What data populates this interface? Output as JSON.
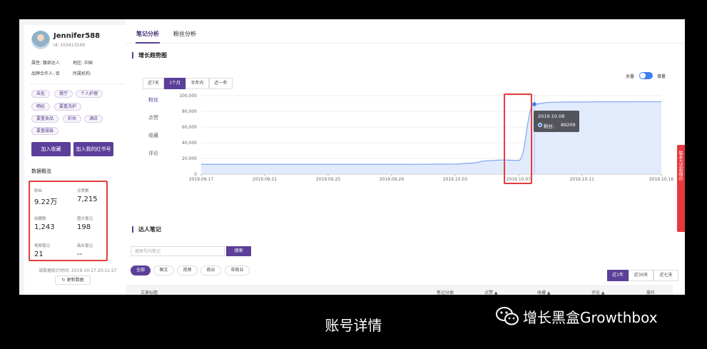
{
  "profile": {
    "name": "Jennifer588",
    "id_text": "id: 103413549",
    "attr_label": "属性: 腰部达人",
    "region": "地区: 中国",
    "brand_coop": "品牌合作人: 否",
    "org": "所属机构:",
    "tags": [
      "去处",
      "餐厅",
      "个人护理",
      "晒娃",
      "要重洗护",
      "要重食品",
      "彩妆",
      "酒店",
      "要重服装"
    ],
    "btn_collect": "加入收藏",
    "btn_redbook": "加入我的红书号"
  },
  "overview": {
    "title": "数据概览",
    "stats": [
      {
        "label": "粉丝",
        "value": "9.22万"
      },
      {
        "label": "点赞数",
        "value": "7,215"
      },
      {
        "label": "收藏数",
        "value": "1,243"
      },
      {
        "label": "图文笔记",
        "value": "198"
      },
      {
        "label": "视频笔记",
        "value": "21"
      },
      {
        "label": "商业笔记",
        "value": "--"
      }
    ],
    "stat_time": "该数据统计时间: 2019-10-17 20:11:57",
    "refresh_label": "更新数据"
  },
  "main": {
    "tabs": [
      "笔记分析",
      "粉丝分析"
    ],
    "trend_title": "增长趋势图",
    "ranges": [
      "近7天",
      "1个月",
      "半年内",
      "近一年"
    ],
    "metrics": [
      "粉丝",
      "点赞",
      "收藏",
      "评论"
    ],
    "toggle_total": "总量",
    "toggle_increase": "增量",
    "notes_title": "达人笔记",
    "search_placeholder": "搜索号内笔记",
    "search_btn": "搜索",
    "filters": [
      "全部",
      "图文",
      "视频",
      "商业",
      "非商业"
    ],
    "periods": [
      "近1年",
      "近30天",
      "近七天"
    ],
    "table_headers": [
      "文章标题",
      "笔记分类",
      "点赞 ▲",
      "收藏 ▲",
      "评论 ▲",
      "操作"
    ]
  },
  "chart_data": {
    "type": "area",
    "x": [
      "2019.09.17",
      "2019.09.18",
      "2019.09.19",
      "2019.09.20",
      "2019.09.21",
      "2019.09.22",
      "2019.09.23",
      "2019.09.24",
      "2019.09.25",
      "2019.09.26",
      "2019.09.27",
      "2019.09.28",
      "2019.09.29",
      "2019.09.30",
      "2019.10.01",
      "2019.10.02",
      "2019.10.03",
      "2019.10.04",
      "2019.10.05",
      "2019.10.06",
      "2019.10.07",
      "2019.10.08",
      "2019.10.09",
      "2019.10.10",
      "2019.10.11",
      "2019.10.12",
      "2019.10.13",
      "2019.10.14",
      "2019.10.15",
      "2019.10.16"
    ],
    "series": [
      {
        "name": "粉丝",
        "values": [
          12500,
          12500,
          12500,
          12500,
          12500,
          12500,
          12500,
          12500,
          12500,
          12500,
          12500,
          12500,
          12500,
          12500,
          12600,
          12700,
          12800,
          14000,
          17000,
          18000,
          17500,
          89209,
          91500,
          92000,
          92000,
          92100,
          92100,
          92200,
          92200,
          92200
        ]
      }
    ],
    "xticks": [
      "2019.09.17",
      "2019.09.21",
      "2019.09.25",
      "2019.09.29",
      "2019.10.03",
      "2019.10.07",
      "2019.10.11",
      "2019.10.16"
    ],
    "yticks": [
      "0",
      "20,000",
      "40,000",
      "60,000",
      "80,000",
      "100,000"
    ],
    "ylim": [
      0,
      100000
    ],
    "grid": true,
    "tooltip_date": "2019.10.08",
    "tooltip_series": "粉丝:",
    "tooltip_value": "89209",
    "colors": {
      "line": "#7ea6f2",
      "fill": "#dde8fc",
      "point": "#3d7ff5"
    }
  },
  "side_tab": "联系方式和报价",
  "caption": "账号详情",
  "brand": "增长黑盒Growthbox",
  "colors": {
    "accent": "#5b3f99",
    "highlight": "#e43d3d",
    "toggle": "#3d7ff5"
  }
}
